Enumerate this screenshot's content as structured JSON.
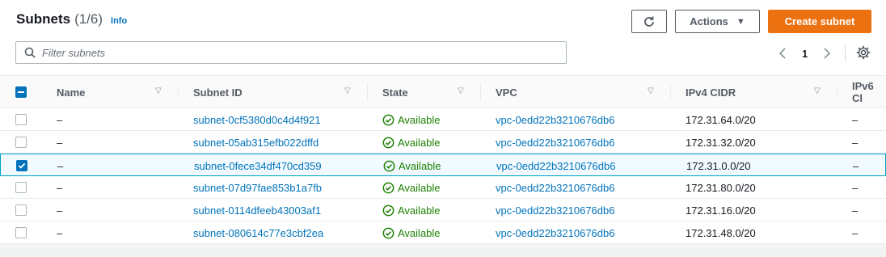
{
  "header": {
    "title": "Subnets",
    "count": "(1/6)",
    "info": "Info"
  },
  "toolbar": {
    "actions_label": "Actions",
    "create_label": "Create subnet"
  },
  "search": {
    "placeholder": "Filter subnets"
  },
  "pagination": {
    "current_page": "1"
  },
  "table": {
    "columns": [
      "Name",
      "Subnet ID",
      "State",
      "VPC",
      "IPv4 CIDR",
      "IPv6 Cl"
    ],
    "rows": [
      {
        "name": "–",
        "subnet_id": "subnet-0cf5380d0c4d4f921",
        "state": "Available",
        "vpc": "vpc-0edd22b3210676db6",
        "ipv4": "172.31.64.0/20",
        "ipv6": "–",
        "selected": false
      },
      {
        "name": "–",
        "subnet_id": "subnet-05ab315efb022dffd",
        "state": "Available",
        "vpc": "vpc-0edd22b3210676db6",
        "ipv4": "172.31.32.0/20",
        "ipv6": "–",
        "selected": false
      },
      {
        "name": "–",
        "subnet_id": "subnet-0fece34df470cd359",
        "state": "Available",
        "vpc": "vpc-0edd22b3210676db6",
        "ipv4": "172.31.0.0/20",
        "ipv6": "–",
        "selected": true
      },
      {
        "name": "–",
        "subnet_id": "subnet-07d97fae853b1a7fb",
        "state": "Available",
        "vpc": "vpc-0edd22b3210676db6",
        "ipv4": "172.31.80.0/20",
        "ipv6": "–",
        "selected": false
      },
      {
        "name": "–",
        "subnet_id": "subnet-0114dfeeb43003af1",
        "state": "Available",
        "vpc": "vpc-0edd22b3210676db6",
        "ipv4": "172.31.16.0/20",
        "ipv6": "–",
        "selected": false
      },
      {
        "name": "–",
        "subnet_id": "subnet-080614c77e3cbf2ea",
        "state": "Available",
        "vpc": "vpc-0edd22b3210676db6",
        "ipv4": "172.31.48.0/20",
        "ipv6": "–",
        "selected": false
      }
    ]
  },
  "colors": {
    "accent": "#ec7211",
    "link": "#0073bb",
    "success": "#1d8102"
  },
  "icons": {
    "refresh": "refresh-icon",
    "search": "search-icon",
    "settings": "gear-icon",
    "available": "check-circle-icon",
    "sort": "sort-caret-icon"
  }
}
